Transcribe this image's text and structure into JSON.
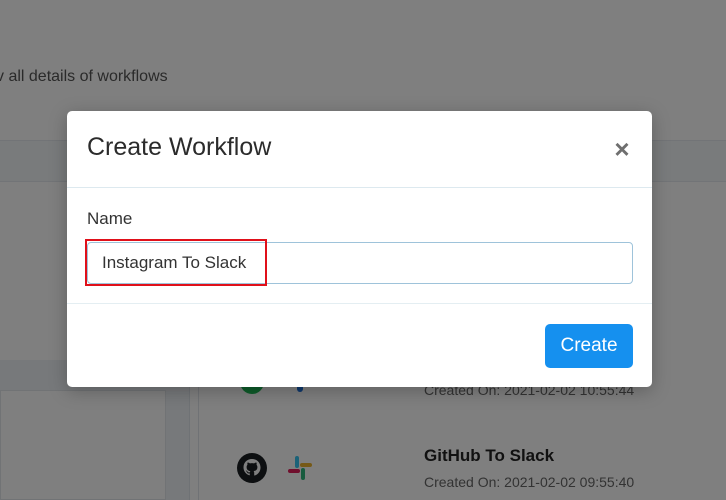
{
  "background": {
    "subtitle": "v all details of workflows",
    "workflows": [
      {
        "title": "",
        "created": "Created On: 2021-02-02 10:55:44"
      },
      {
        "title": "GitHub To Slack",
        "created": "Created On: 2021-02-02 09:55:40"
      }
    ]
  },
  "modal": {
    "title": "Create Workflow",
    "close_glyph": "×",
    "name_label": "Name",
    "name_value": "Instagram To Slack",
    "create_label": "Create"
  },
  "colors": {
    "primary_button": "#1590ef",
    "highlight": "#e0101a",
    "overlay": "rgba(0,0,0,0.5)"
  },
  "icons": [
    "github-icon",
    "slack-icon"
  ]
}
